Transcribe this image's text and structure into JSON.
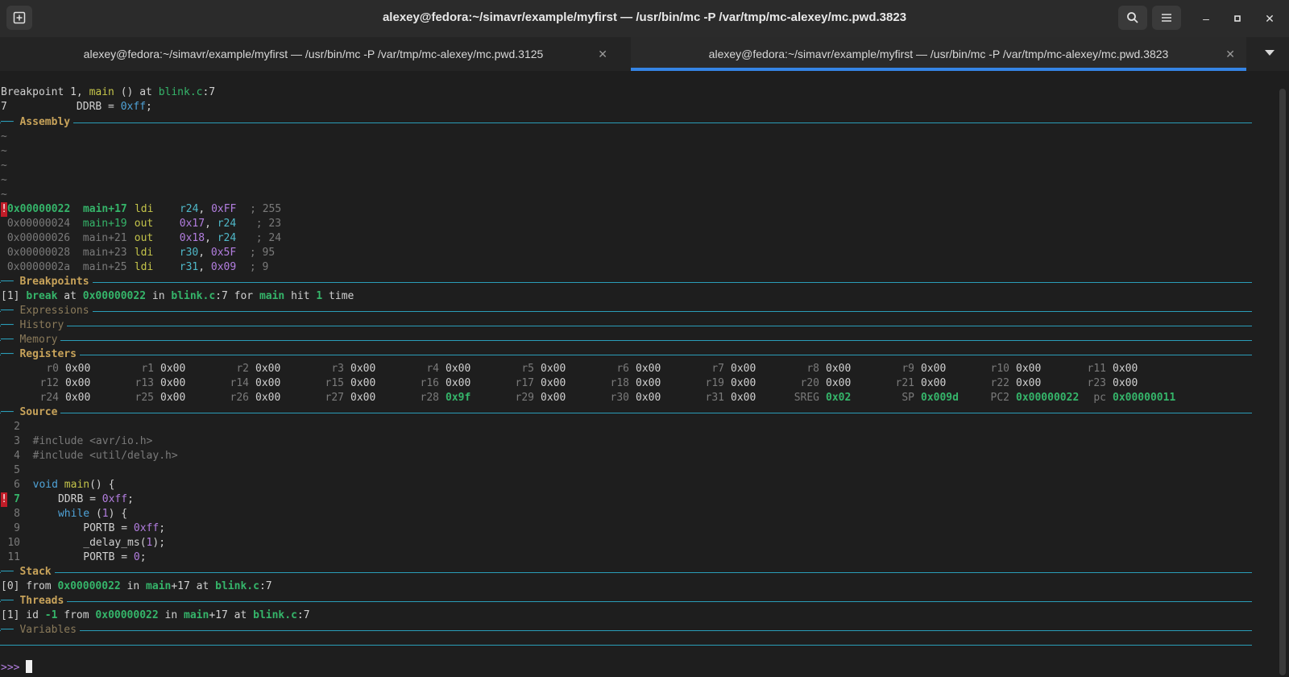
{
  "window": {
    "title": "alexey@fedora:~/simavr/example/myfirst — /usr/bin/mc -P /var/tmp/mc-alexey/mc.pwd.3823"
  },
  "tabs": [
    {
      "label": "alexey@fedora:~/simavr/example/myfirst — /usr/bin/mc -P /var/tmp/mc-alexey/mc.pwd.3125",
      "active": false
    },
    {
      "label": "alexey@fedora:~/simavr/example/myfirst — /usr/bin/mc -P /var/tmp/mc-alexey/mc.pwd.3823",
      "active": true
    }
  ],
  "header": {
    "bp_text": "Breakpoint 1, ",
    "bp_func": "main",
    "bp_mid": " () at ",
    "bp_file": "blink.c",
    "bp_line": ":7",
    "src_num": "7",
    "src_code": "           DDRB = ",
    "src_val": "0xff",
    "src_end": ";"
  },
  "sections": {
    "assembly": "Assembly",
    "breakpoints": "Breakpoints",
    "expressions": "Expressions",
    "history": "History",
    "memory": "Memory",
    "registers": "Registers",
    "source": "Source",
    "stack": "Stack",
    "threads": "Threads",
    "variables": "Variables"
  },
  "assembly": {
    "tildes": [
      "~",
      "~",
      "~",
      "~",
      "~"
    ],
    "rows": [
      {
        "mark": "!",
        "addr": "0x00000022",
        "func": "main+17",
        "op": "ldi",
        "a1": "r24",
        "a2": "0xFF",
        "cmt": "; 255",
        "current": true
      },
      {
        "mark": " ",
        "addr": "0x00000024",
        "func": "main+19",
        "op": "out",
        "a1": "0x17",
        "a2": "r24",
        "cmt": "; 23",
        "current": false
      },
      {
        "mark": " ",
        "addr": "0x00000026",
        "func": "main+21",
        "op": "out",
        "a1": "0x18",
        "a2": "r24",
        "cmt": "; 24",
        "current": false
      },
      {
        "mark": " ",
        "addr": "0x00000028",
        "func": "main+23",
        "op": "ldi",
        "a1": "r30",
        "a2": "0x5F",
        "cmt": "; 95",
        "current": false
      },
      {
        "mark": " ",
        "addr": "0x0000002a",
        "func": "main+25",
        "op": "ldi",
        "a1": "r31",
        "a2": "0x09",
        "cmt": "; 9",
        "current": false
      }
    ]
  },
  "breakpoints": {
    "idx": "[1]",
    "kind": "break",
    "at": " at ",
    "addr": "0x00000022",
    "in": " in ",
    "file": "blink.c",
    "line": ":7",
    "for": " for ",
    "func": "main",
    "hit": " hit ",
    "count": "1",
    "time": " time"
  },
  "registers": [
    [
      [
        "r0",
        "0x00"
      ],
      [
        "r1",
        "0x00"
      ],
      [
        "r2",
        "0x00"
      ],
      [
        "r3",
        "0x00"
      ],
      [
        "r4",
        "0x00"
      ],
      [
        "r5",
        "0x00"
      ],
      [
        "r6",
        "0x00"
      ],
      [
        "r7",
        "0x00"
      ],
      [
        "r8",
        "0x00"
      ],
      [
        "r9",
        "0x00"
      ],
      [
        "r10",
        "0x00"
      ],
      [
        "r11",
        "0x00"
      ]
    ],
    [
      [
        "r12",
        "0x00"
      ],
      [
        "r13",
        "0x00"
      ],
      [
        "r14",
        "0x00"
      ],
      [
        "r15",
        "0x00"
      ],
      [
        "r16",
        "0x00"
      ],
      [
        "r17",
        "0x00"
      ],
      [
        "r18",
        "0x00"
      ],
      [
        "r19",
        "0x00"
      ],
      [
        "r20",
        "0x00"
      ],
      [
        "r21",
        "0x00"
      ],
      [
        "r22",
        "0x00"
      ],
      [
        "r23",
        "0x00"
      ]
    ],
    [
      [
        "r24",
        "0x00"
      ],
      [
        "r25",
        "0x00"
      ],
      [
        "r26",
        "0x00"
      ],
      [
        "r27",
        "0x00"
      ],
      [
        "r28",
        "0x9f"
      ],
      [
        "r29",
        "0x00"
      ],
      [
        "r30",
        "0x00"
      ],
      [
        "r31",
        "0x00"
      ],
      [
        "SREG",
        "0x02"
      ],
      [
        "SP",
        "0x009d"
      ],
      [
        "PC2",
        "0x00000022"
      ],
      [
        "pc",
        "0x00000011"
      ]
    ]
  ],
  "source": [
    {
      "num": "2",
      "code": ""
    },
    {
      "num": "3",
      "code": "#include <avr/io.h>"
    },
    {
      "num": "4",
      "code": "#include <util/delay.h>"
    },
    {
      "num": "5",
      "code": ""
    },
    {
      "num": "6",
      "kw": "void ",
      "fn": "main",
      "rest": "() {"
    },
    {
      "num": "7",
      "current": true,
      "pre": "    DDRB = ",
      "val": "0xff",
      "post": ";"
    },
    {
      "num": "8",
      "kw": "    while ",
      "pre2": "(",
      "val": "1",
      "post": ") {"
    },
    {
      "num": "9",
      "pre": "        PORTB = ",
      "val": "0xff",
      "post": ";"
    },
    {
      "num": "10",
      "pre": "        _delay_ms(",
      "val": "1",
      "post": ");"
    },
    {
      "num": "11",
      "pre": "        PORTB = ",
      "val": "0",
      "post": ";"
    }
  ],
  "stack": {
    "idx": "[0]",
    "from": " from ",
    "addr": "0x00000022",
    "in": " in ",
    "func": "main",
    "off": "+17",
    "at": " at ",
    "file": "blink.c",
    "line": ":7"
  },
  "threads": {
    "idx": "[1]",
    "id": " id ",
    "idv": "-1",
    "from": " from ",
    "addr": "0x00000022",
    "in": " in ",
    "func": "main",
    "off": "+17",
    "at": " at ",
    "file": "blink.c",
    "line": ":7"
  },
  "prompt": ">>>",
  "colors": {
    "accent": "#3584e4",
    "separator": "#2a9db8",
    "breakpoint": "#c01c28"
  }
}
